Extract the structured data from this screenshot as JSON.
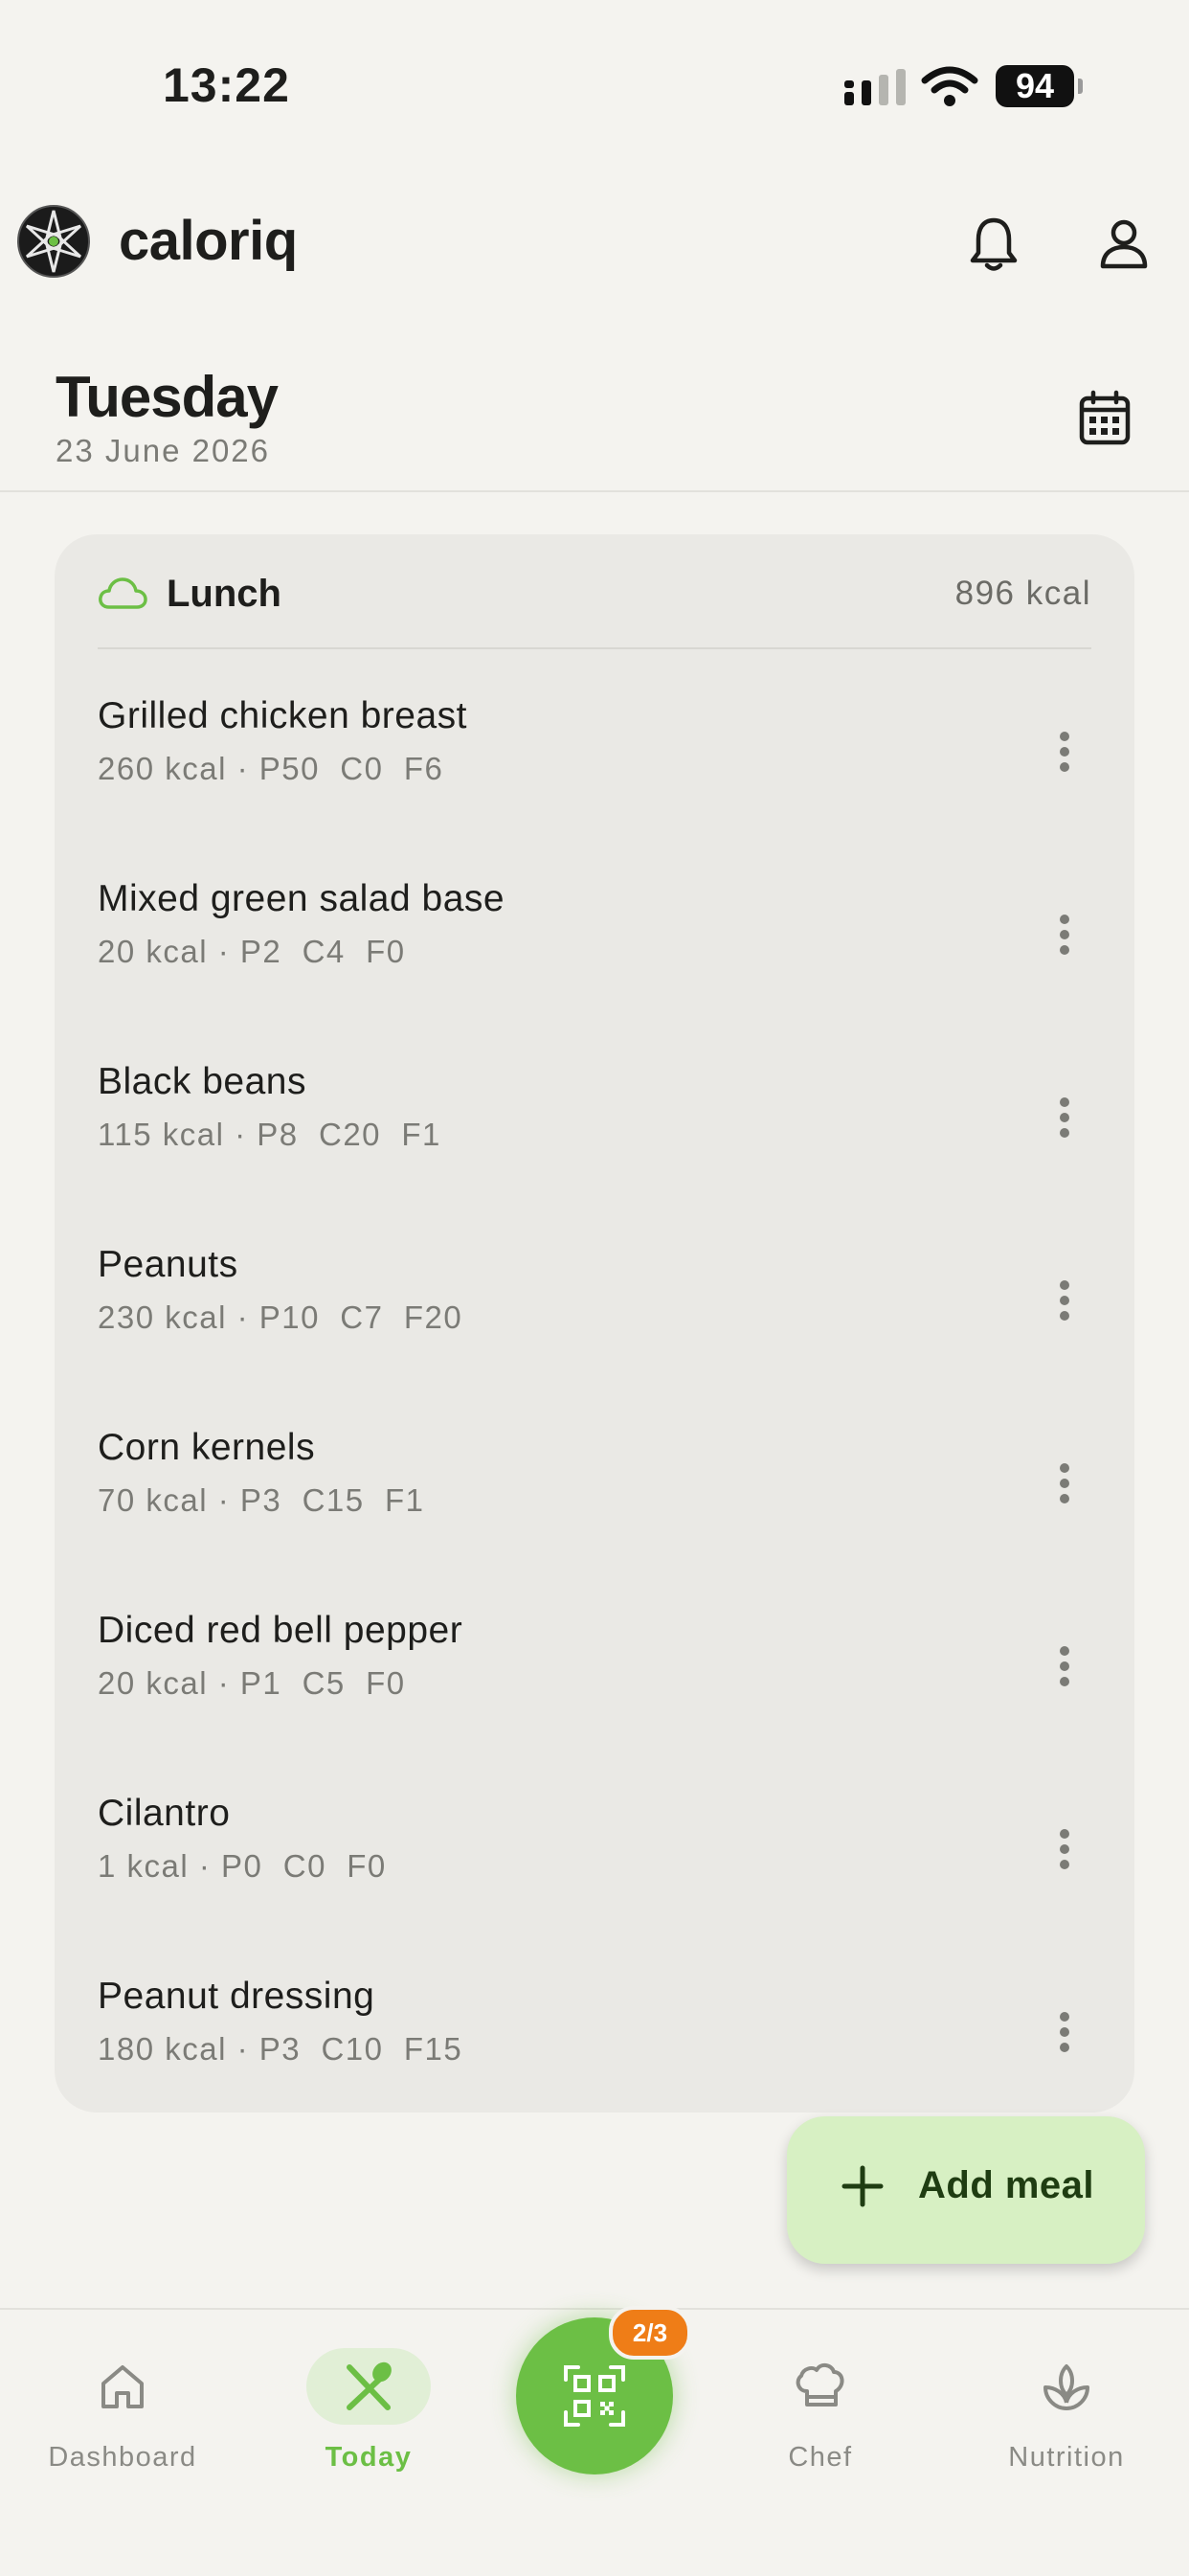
{
  "status_bar": {
    "time": "13:22",
    "battery": "94"
  },
  "header": {
    "brand": "caloriq"
  },
  "date": {
    "day": "Tuesday",
    "full_date": "23 June 2026"
  },
  "meal": {
    "name": "Lunch",
    "kcal": "896 kcal",
    "items": [
      {
        "name": "Grilled chicken breast",
        "meta": "260 kcal · P50  C0  F6"
      },
      {
        "name": "Mixed green salad base",
        "meta": "20 kcal · P2  C4  F0"
      },
      {
        "name": "Black beans",
        "meta": "115 kcal · P8  C20  F1"
      },
      {
        "name": "Peanuts",
        "meta": "230 kcal · P10  C7  F20"
      },
      {
        "name": "Corn kernels",
        "meta": "70 kcal · P3  C15  F1"
      },
      {
        "name": "Diced red bell pepper",
        "meta": "20 kcal · P1  C5  F0"
      },
      {
        "name": "Cilantro",
        "meta": "1 kcal · P0  C0  F0"
      },
      {
        "name": "Peanut dressing",
        "meta": "180 kcal · P3  C10  F15"
      }
    ]
  },
  "fab": {
    "label": "Add meal"
  },
  "nav": {
    "items": [
      {
        "label": "Dashboard",
        "icon": "home-icon"
      },
      {
        "label": "Today",
        "icon": "fork-spoon-icon",
        "active": true
      },
      {
        "label": "Chef",
        "icon": "chef-hat-icon"
      },
      {
        "label": "Nutrition",
        "icon": "sprout-icon"
      }
    ],
    "scan_badge": "2/3"
  },
  "colors": {
    "accent": "#6cbf45",
    "fab_bg": "#d7f0c3",
    "badge": "#ef7d17",
    "card_bg": "#eae9e5",
    "page_bg": "#f4f3ef"
  }
}
